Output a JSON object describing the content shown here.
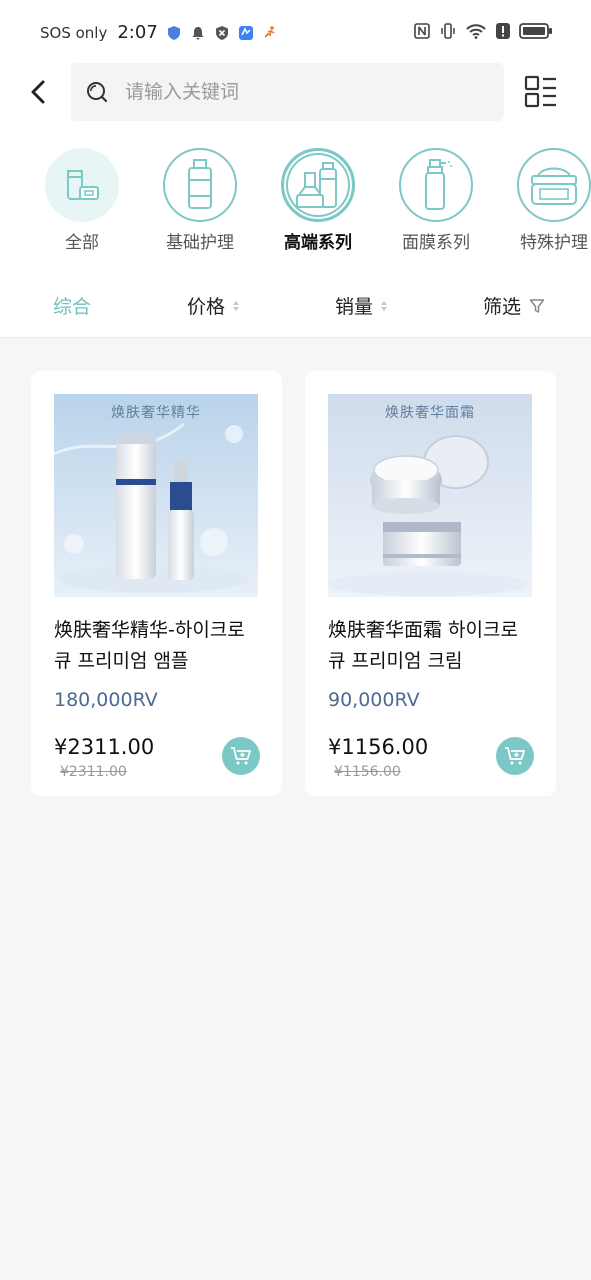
{
  "status_bar": {
    "carrier": "SOS only",
    "time": "2:07",
    "icons_left": [
      "shield-icon",
      "bell-icon",
      "blocked-icon",
      "app-icon",
      "runner-icon"
    ],
    "icons_right": [
      "nfc-icon",
      "vibrate-icon",
      "wifi-icon",
      "alert-icon",
      "battery-icon"
    ]
  },
  "header": {
    "search_placeholder": "请输入关键词",
    "icons": [
      "back-chevron-icon",
      "search-icon",
      "grid-list-icon"
    ]
  },
  "categories": [
    {
      "label": "全部",
      "icon": "all-products-icon",
      "state": "filled"
    },
    {
      "label": "基础护理",
      "icon": "basic-care-icon",
      "state": "normal"
    },
    {
      "label": "高端系列",
      "icon": "premium-series-icon",
      "state": "active"
    },
    {
      "label": "面膜系列",
      "icon": "mask-series-icon",
      "state": "normal"
    },
    {
      "label": "特殊护理",
      "icon": "special-care-icon",
      "state": "normal"
    }
  ],
  "sort_bar": {
    "comprehensive": "综合",
    "price": "价格",
    "sales": "销量",
    "filter": "筛选"
  },
  "products": [
    {
      "image_caption": "焕肤奢华精华",
      "title": "焕肤奢华精华-하이크로 큐 프리미엄 앰플",
      "points": "180,000RV",
      "price": "¥2311.00",
      "old_price": "¥2311.00"
    },
    {
      "image_caption": "焕肤奢华面霜",
      "title": "焕肤奢华面霜 하이크로 큐 프리미엄 크림",
      "points": "90,000RV",
      "price": "¥1156.00",
      "old_price": "¥1156.00"
    }
  ],
  "colors": {
    "accent": "#7cc8c6",
    "points": "#4d6a95",
    "background": "#f6f6f6"
  }
}
